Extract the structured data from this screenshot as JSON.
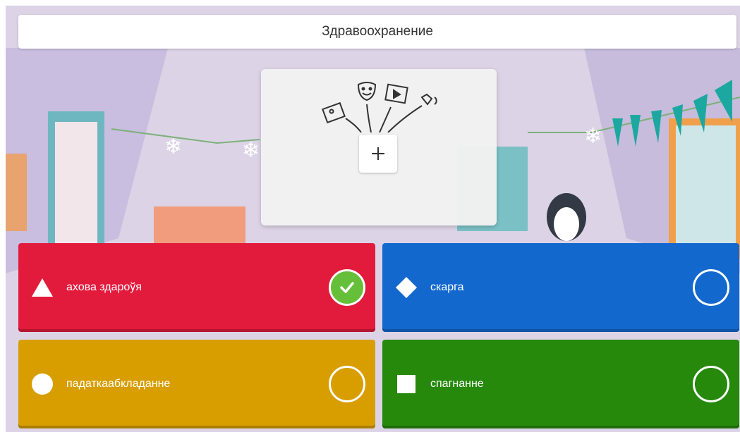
{
  "question": {
    "title": "Здравоохранение"
  },
  "media": {
    "add_icon": "plus-icon",
    "illustration_icons": [
      "image-icon",
      "theater-mask-icon",
      "video-icon",
      "audio-icon"
    ]
  },
  "answers": [
    {
      "label": "ахова здароўя",
      "shape": "triangle",
      "color": "#e21b3c",
      "correct": true
    },
    {
      "label": "скарга",
      "shape": "diamond",
      "color": "#1368ce",
      "correct": false
    },
    {
      "label": "падаткаабкладанне",
      "shape": "circle",
      "color": "#d89e00",
      "correct": false
    },
    {
      "label": "спагнанне",
      "shape": "square",
      "color": "#26890c",
      "correct": false
    }
  ],
  "colors": {
    "correct_check": "#66bf39"
  }
}
